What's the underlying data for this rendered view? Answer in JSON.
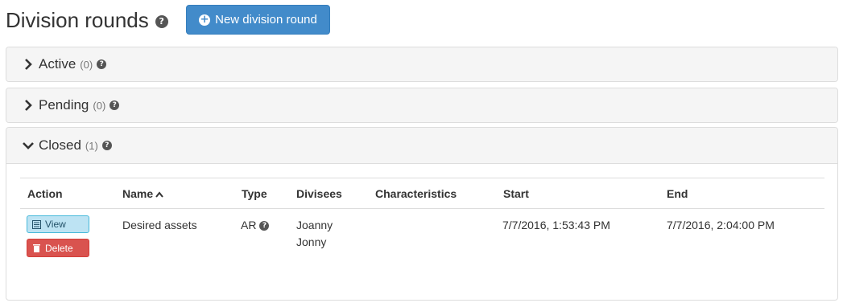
{
  "header": {
    "title": "Division rounds",
    "new_button_label": "New division round"
  },
  "panels": {
    "active": {
      "label": "Active",
      "count": "(0)"
    },
    "pending": {
      "label": "Pending",
      "count": "(0)"
    },
    "closed": {
      "label": "Closed",
      "count": "(1)"
    }
  },
  "table": {
    "columns": [
      "Action",
      "Name",
      "Type",
      "Divisees",
      "Characteristics",
      "Start",
      "End"
    ],
    "rows": [
      {
        "view_label": "View",
        "delete_label": "Delete",
        "name": "Desired assets",
        "type": "AR",
        "divisees": [
          "Joanny",
          "Jonny"
        ],
        "characteristics": "",
        "start": "7/7/2016, 1:53:43 PM",
        "end": "7/7/2016, 2:04:00 PM"
      }
    ]
  },
  "colors": {
    "primary": "#428bca",
    "info_bg": "#bde3f3",
    "danger": "#d9534f",
    "panel_heading_bg": "#f5f5f5"
  },
  "icons": {
    "help": "question-circle-icon",
    "new": "plus-circle-icon",
    "collapsed": "chevron-right-icon",
    "expanded": "chevron-down-icon",
    "sort": "chevron-up-icon",
    "view": "list-alt-icon",
    "delete": "trash-icon"
  }
}
